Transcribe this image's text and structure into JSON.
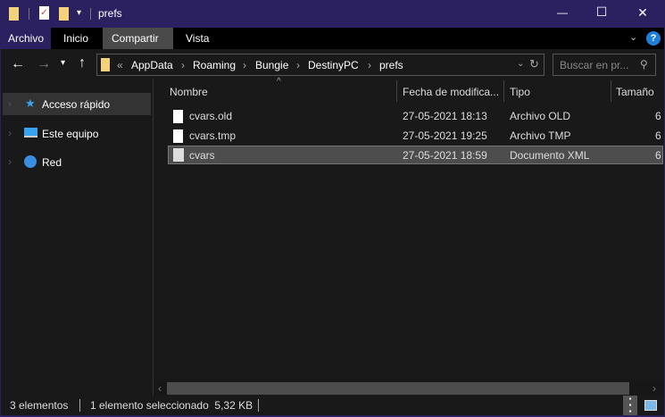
{
  "window": {
    "title": "prefs",
    "minimize": "—",
    "maximize": "☐",
    "close": "✕"
  },
  "ribbon": {
    "tabs": [
      "Archivo",
      "Inicio",
      "Compartir",
      "Vista"
    ],
    "help": "?"
  },
  "address": {
    "overflow": "«",
    "crumbs": [
      "AppData",
      "Roaming",
      "Bungie",
      "DestinyPC",
      "prefs"
    ],
    "search_placeholder": "Buscar en pr..."
  },
  "nav": {
    "items": [
      "Acceso rápido",
      "Este equipo",
      "Red"
    ]
  },
  "columns": [
    "Nombre",
    "Fecha de modifica...",
    "Tipo",
    "Tamaño"
  ],
  "files": [
    {
      "name": "cvars.old",
      "date": "27-05-2021 18:13",
      "type": "Archivo OLD",
      "size": "6",
      "selected": false
    },
    {
      "name": "cvars.tmp",
      "date": "27-05-2021 19:25",
      "type": "Archivo TMP",
      "size": "6",
      "selected": false
    },
    {
      "name": "cvars",
      "date": "27-05-2021 18:59",
      "type": "Documento XML",
      "size": "6",
      "selected": true
    }
  ],
  "status": {
    "count": "3 elementos",
    "selection": "1 elemento seleccionado  5,32 KB"
  }
}
